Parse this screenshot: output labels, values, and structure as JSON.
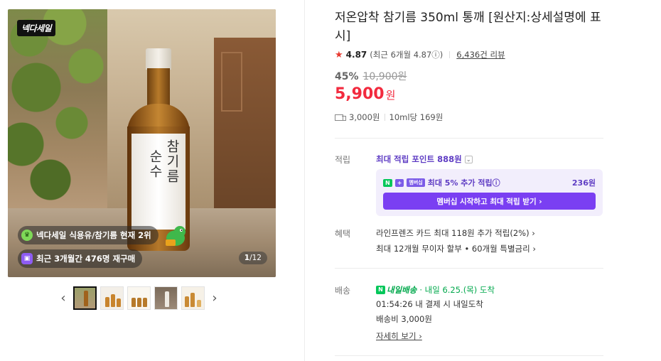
{
  "gallery": {
    "badge": "넥다세일",
    "bottle_label": {
      "line1": "참기름",
      "line2": "순수"
    },
    "rank_chip": "넥다세일 식용유/참기름 현재 2위",
    "repurchase_chip": "최근 3개월간 476명 재구매",
    "counter": {
      "current": "1",
      "total": "/12"
    },
    "prev_arrow": "‹",
    "next_arrow": "›",
    "thumb_count": 5
  },
  "product": {
    "title": "저온압착 참기름 350ml 통깨 [원산지:상세설명에 표시]",
    "rating": "4.87",
    "rating_recent": "(최근 6개월 4.87ⓘ)",
    "review_count": "6,436건 리뷰",
    "discount_rate": "45%",
    "original_price": "10,900원",
    "price": "5,900",
    "price_unit": "원",
    "shipping_fee": "3,000원",
    "unit_price": "10ml당 169원"
  },
  "points": {
    "label": "적립",
    "max_points_text": "최대 적립 포인트",
    "max_points_value": "888원",
    "membership": {
      "n_badge": "N",
      "plus_badge": "+",
      "tag": "멤버십",
      "text": "최대 5% 추가 적립ⓘ",
      "amount": "236원",
      "button": "멤버십 시작하고 최대 적립 받기 ›"
    }
  },
  "benefits": {
    "label": "혜택",
    "items": [
      "라인프렌즈 카드 최대 118원 추가 적립(2%) ›",
      "최대 12개월 무이자 할부 • 60개월 특별금리 ›"
    ]
  },
  "delivery": {
    "label": "배송",
    "badge": "내일배송",
    "eta": "· 내일 6.25.(목) 도착",
    "cutoff": "01:54:26  내 결제 시 내일도착",
    "fee": "배송비 3,000원",
    "detail_link": "자세히 보기 ›"
  },
  "colors": {
    "price_red": "#f22a3e",
    "membership_purple": "#7a3ff2",
    "naver_green": "#03c75a"
  }
}
